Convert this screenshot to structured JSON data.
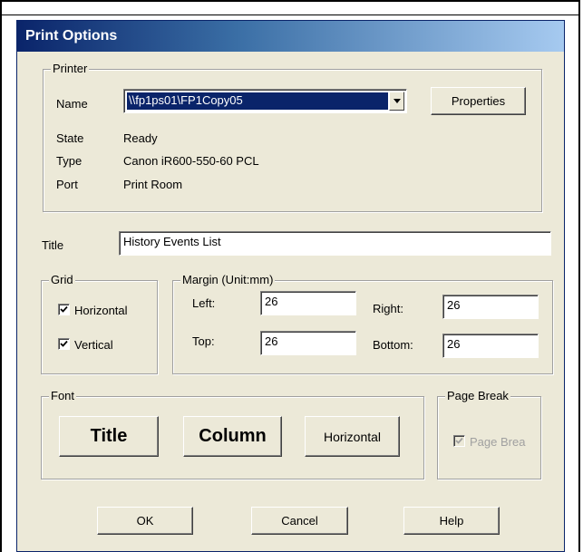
{
  "dialog": {
    "title": "Print Options"
  },
  "printer": {
    "legend": "Printer",
    "name_label": "Name",
    "name_value": "\\\\fp1ps01\\FP1Copy05",
    "properties_button": "Properties",
    "state_label": "State",
    "state_value": "Ready",
    "type_label": "Type",
    "type_value": "Canon iR600-550-60 PCL",
    "port_label": "Port",
    "port_value": "Print Room"
  },
  "title_field": {
    "label": "Title",
    "value": "History Events List"
  },
  "grid": {
    "legend": "Grid",
    "horizontal_label": "Horizontal",
    "horizontal_checked": true,
    "vertical_label": "Vertical",
    "vertical_checked": true
  },
  "margin": {
    "legend": "Margin (Unit:mm)",
    "left_label": "Left:",
    "left_value": "26",
    "right_label": "Right:",
    "right_value": "26",
    "top_label": "Top:",
    "top_value": "26",
    "bottom_label": "Bottom:",
    "bottom_value": "26"
  },
  "font": {
    "legend": "Font",
    "title_button": "Title",
    "column_button": "Column",
    "horizontal_button": "Horizontal"
  },
  "page_break": {
    "legend": "Page Break",
    "checkbox_label": "Page Brea",
    "checked": true,
    "disabled": true
  },
  "footer": {
    "ok": "OK",
    "cancel": "Cancel",
    "help": "Help"
  },
  "colors": {
    "titlebar": "#0a246a",
    "selection": "#0a246a",
    "dialog_bg": "#ece9d8"
  },
  "icons": {
    "dropdown": "chevron-down-icon",
    "check": "checkmark-icon"
  }
}
